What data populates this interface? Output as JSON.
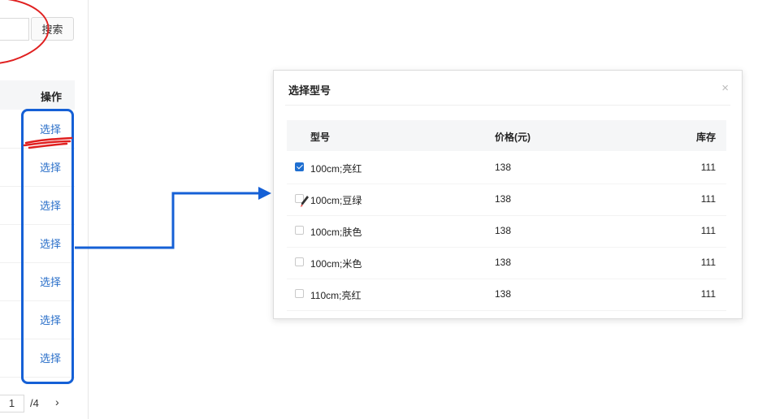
{
  "left_panel": {
    "search_button": "搜索",
    "column_operation": "操作",
    "rows": [
      {
        "action": "选择"
      },
      {
        "action": "选择"
      },
      {
        "action": "选择"
      },
      {
        "action": "选择"
      },
      {
        "action": "选择"
      },
      {
        "action": "选择"
      },
      {
        "action": "选择"
      }
    ],
    "pager": {
      "current": "1",
      "total": "/4",
      "next": "›"
    }
  },
  "modal": {
    "title": "选择型号",
    "close": "×",
    "headers": {
      "model": "型号",
      "price": "价格(元)",
      "stock": "库存"
    },
    "rows": [
      {
        "model": "100cm;亮红",
        "price": "138",
        "stock": "111",
        "checked": true
      },
      {
        "model": "100cm;豆绿",
        "price": "138",
        "stock": "111",
        "checked": false
      },
      {
        "model": "100cm;肤色",
        "price": "138",
        "stock": "111",
        "checked": false
      },
      {
        "model": "100cm;米色",
        "price": "138",
        "stock": "111",
        "checked": false
      },
      {
        "model": "110cm;亮红",
        "price": "138",
        "stock": "111",
        "checked": false
      }
    ]
  },
  "colors": {
    "link": "#2a6fc9",
    "checkbox_checked": "#1f6fd1",
    "annotation_blue": "#1560d6",
    "annotation_red": "#e02020"
  }
}
